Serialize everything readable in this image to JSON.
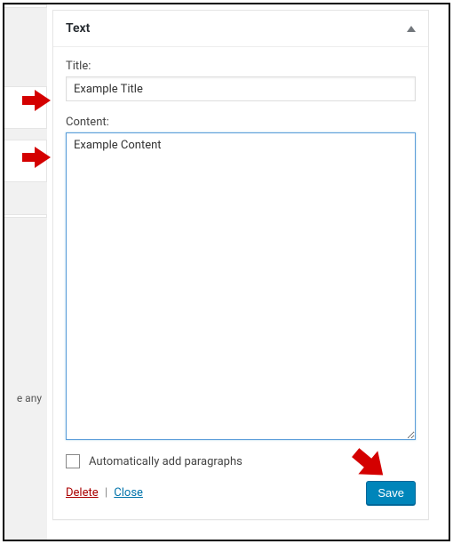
{
  "widget": {
    "header_title": "Text",
    "title_label": "Title:",
    "title_value": "Example Title",
    "content_label": "Content:",
    "content_value": "Example Content",
    "autop_label": "Automatically add paragraphs",
    "delete_label": "Delete",
    "close_label": "Close",
    "save_label": "Save"
  },
  "background": {
    "partial_text": "e any"
  }
}
